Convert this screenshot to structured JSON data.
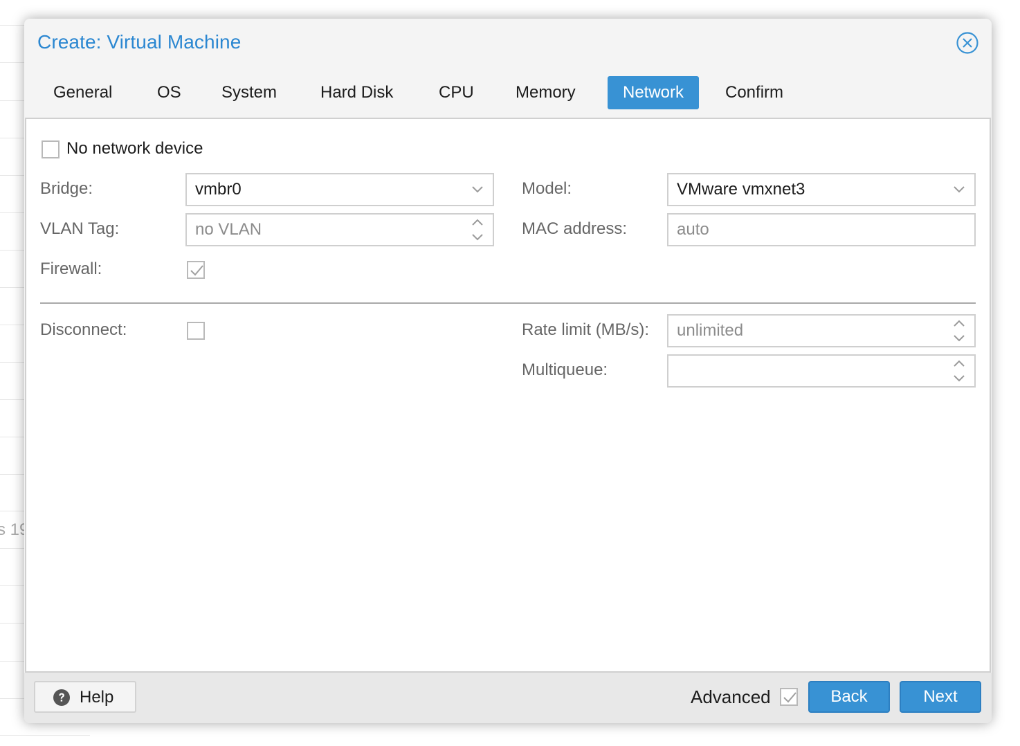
{
  "dialog": {
    "title": "Create: Virtual Machine",
    "close_icon": "close-circle-icon"
  },
  "tabs": [
    {
      "label": "General",
      "active": false
    },
    {
      "label": "OS",
      "active": false
    },
    {
      "label": "System",
      "active": false
    },
    {
      "label": "Hard Disk",
      "active": false
    },
    {
      "label": "CPU",
      "active": false
    },
    {
      "label": "Memory",
      "active": false
    },
    {
      "label": "Network",
      "active": true
    },
    {
      "label": "Confirm",
      "active": false
    }
  ],
  "form": {
    "no_network_device": {
      "label": "No network device",
      "checked": false
    },
    "bridge": {
      "label": "Bridge:",
      "value": "vmbr0"
    },
    "vlan_tag": {
      "label": "VLAN Tag:",
      "placeholder": "no VLAN"
    },
    "firewall": {
      "label": "Firewall:",
      "checked": true
    },
    "model": {
      "label": "Model:",
      "value": "VMware vmxnet3"
    },
    "mac_address": {
      "label": "MAC address:",
      "placeholder": "auto"
    },
    "disconnect": {
      "label": "Disconnect:",
      "checked": false
    },
    "rate_limit": {
      "label": "Rate limit (MB/s):",
      "placeholder": "unlimited"
    },
    "multiqueue": {
      "label": "Multiqueue:",
      "value": ""
    }
  },
  "footer": {
    "help_label": "Help",
    "advanced_label": "Advanced",
    "advanced_checked": true,
    "back_label": "Back",
    "next_label": "Next"
  },
  "background": {
    "partial_text": "s 19"
  },
  "colors": {
    "accent": "#3892d4",
    "title": "#2b87d1"
  }
}
